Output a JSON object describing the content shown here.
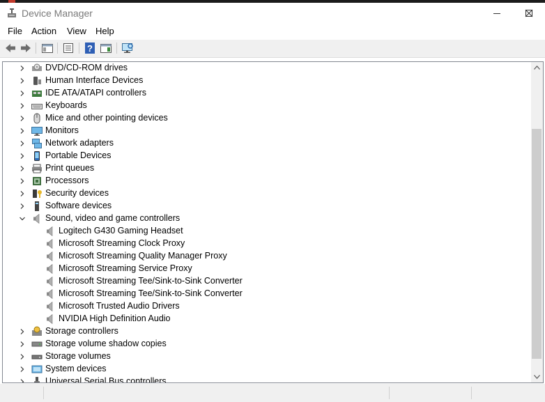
{
  "window": {
    "title": "Device Manager",
    "minimize_icon": "minimize-icon",
    "maximize_icon": "maximize-icon",
    "close_icon": "close-icon"
  },
  "menu": [
    "File",
    "Action",
    "View",
    "Help"
  ],
  "toolbar": {
    "buttons": [
      "back-arrow-icon",
      "forward-arrow-icon",
      "show-hide-console-tree-icon",
      "properties-icon",
      "help-icon",
      "action-pane-icon",
      "scan-hardware-changes-icon"
    ]
  },
  "tree": [
    {
      "label": "DVD/CD-ROM drives",
      "icon": "dvd-drive-icon",
      "expanded": false,
      "level": 0
    },
    {
      "label": "Human Interface Devices",
      "icon": "hid-icon",
      "expanded": false,
      "level": 0
    },
    {
      "label": "IDE ATA/ATAPI controllers",
      "icon": "ide-controller-icon",
      "expanded": false,
      "level": 0
    },
    {
      "label": "Keyboards",
      "icon": "keyboard-icon",
      "expanded": false,
      "level": 0
    },
    {
      "label": "Mice and other pointing devices",
      "icon": "mouse-icon",
      "expanded": false,
      "level": 0
    },
    {
      "label": "Monitors",
      "icon": "monitor-icon",
      "expanded": false,
      "level": 0
    },
    {
      "label": "Network adapters",
      "icon": "network-adapter-icon",
      "expanded": false,
      "level": 0
    },
    {
      "label": "Portable Devices",
      "icon": "portable-device-icon",
      "expanded": false,
      "level": 0
    },
    {
      "label": "Print queues",
      "icon": "printer-icon",
      "expanded": false,
      "level": 0
    },
    {
      "label": "Processors",
      "icon": "processor-icon",
      "expanded": false,
      "level": 0
    },
    {
      "label": "Security devices",
      "icon": "security-device-icon",
      "expanded": false,
      "level": 0
    },
    {
      "label": "Software devices",
      "icon": "software-device-icon",
      "expanded": false,
      "level": 0
    },
    {
      "label": "Sound, video and game controllers",
      "icon": "speaker-icon",
      "expanded": true,
      "level": 0
    },
    {
      "label": "Logitech G430 Gaming Headset",
      "icon": "speaker-icon",
      "level": 1
    },
    {
      "label": "Microsoft Streaming Clock Proxy",
      "icon": "speaker-icon",
      "level": 1
    },
    {
      "label": "Microsoft Streaming Quality Manager Proxy",
      "icon": "speaker-icon",
      "level": 1
    },
    {
      "label": "Microsoft Streaming Service Proxy",
      "icon": "speaker-icon",
      "level": 1
    },
    {
      "label": "Microsoft Streaming Tee/Sink-to-Sink Converter",
      "icon": "speaker-icon",
      "level": 1
    },
    {
      "label": "Microsoft Streaming Tee/Sink-to-Sink Converter",
      "icon": "speaker-icon",
      "level": 1
    },
    {
      "label": "Microsoft Trusted Audio Drivers",
      "icon": "speaker-icon",
      "level": 1
    },
    {
      "label": "NVIDIA High Definition Audio",
      "icon": "speaker-icon",
      "level": 1
    },
    {
      "label": "Storage controllers",
      "icon": "storage-controller-icon",
      "expanded": false,
      "level": 0
    },
    {
      "label": "Storage volume shadow copies",
      "icon": "shadow-copy-icon",
      "expanded": false,
      "level": 0
    },
    {
      "label": "Storage volumes",
      "icon": "storage-volume-icon",
      "expanded": false,
      "level": 0
    },
    {
      "label": "System devices",
      "icon": "system-device-icon",
      "expanded": false,
      "level": 0
    },
    {
      "label": "Universal Serial Bus controllers",
      "icon": "usb-icon",
      "expanded": false,
      "level": 0
    }
  ],
  "colors": {
    "toolbar_bg": "#f0f0f0",
    "border": "#828790",
    "scroll_thumb": "#cdcdcd"
  }
}
